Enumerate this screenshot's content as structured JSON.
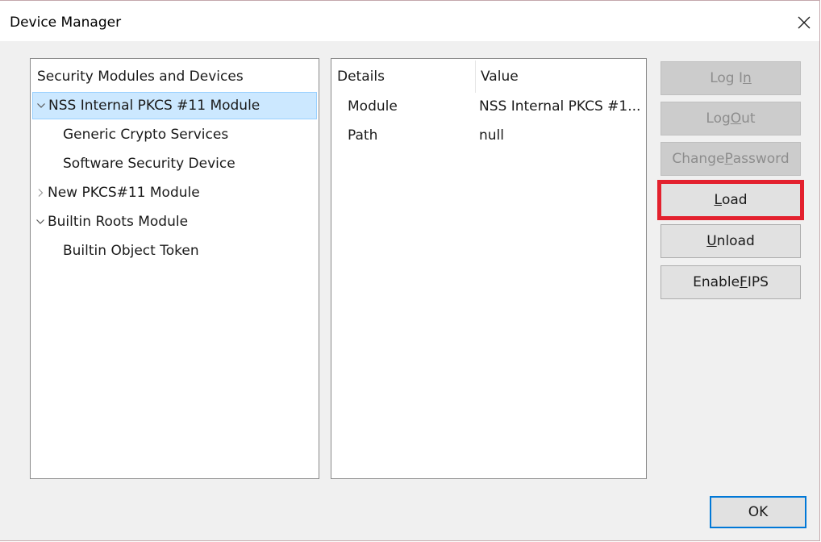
{
  "window": {
    "title": "Device Manager"
  },
  "tree": {
    "header": "Security Modules and Devices",
    "items": [
      {
        "label": "NSS Internal PKCS #11 Module",
        "expanded": true,
        "selected": true
      },
      {
        "label": "Generic Crypto Services"
      },
      {
        "label": "Software Security Device"
      },
      {
        "label": "New PKCS#11 Module",
        "expanded": false
      },
      {
        "label": "Builtin Roots Module",
        "expanded": true
      },
      {
        "label": "Builtin Object Token"
      }
    ]
  },
  "details": {
    "columns": [
      "Details",
      "Value"
    ],
    "rows": [
      {
        "name": "Module",
        "value": "NSS Internal PKCS #1..."
      },
      {
        "name": "Path",
        "value": "null"
      }
    ]
  },
  "buttons": {
    "login": {
      "pre": "Log I",
      "key": "n",
      "post": ""
    },
    "logout": {
      "pre": "Log ",
      "key": "O",
      "post": "ut"
    },
    "change_password": {
      "pre": "Change ",
      "key": "P",
      "post": "assword"
    },
    "load": {
      "pre": "",
      "key": "L",
      "post": "oad"
    },
    "unload": {
      "pre": "",
      "key": "U",
      "post": "nload"
    },
    "enable_fips": {
      "pre": "Enable ",
      "key": "F",
      "post": "IPS"
    },
    "ok": "OK"
  },
  "colors": {
    "selection": "#cce8ff",
    "highlight": "#e3212e",
    "focus": "#0078d7"
  },
  "icons": {
    "close": "close-icon",
    "expanded": "chevron-down-icon",
    "collapsed": "chevron-right-icon"
  }
}
